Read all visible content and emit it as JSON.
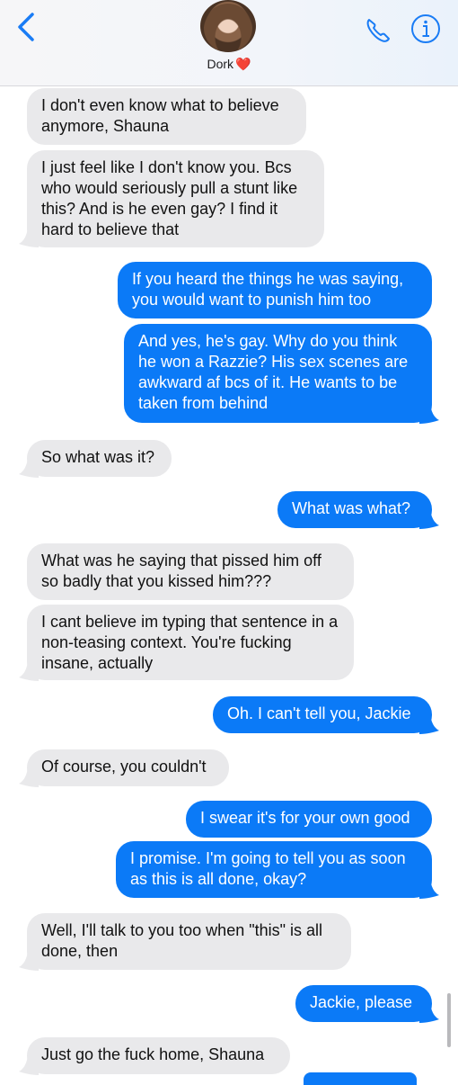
{
  "header": {
    "contact_name": "Dork",
    "heart_icon": "❤️",
    "back_icon": "chevron-left-icon",
    "phone_icon": "phone-icon",
    "info_icon": "info-icon",
    "accent": "#1a7cf5"
  },
  "colors": {
    "sent": "#0b7af7",
    "received": "#e9e9eb"
  },
  "messages": [
    {
      "dir": "received",
      "text": "I don't even know what to believe anymore, Shauna"
    },
    {
      "dir": "received",
      "text": "I just feel like I don't know you. Bcs who would seriously pull a stunt like this? And is he even gay? I find it hard to believe that"
    },
    {
      "dir": "sent",
      "text": "If you heard the things he was saying, you would want to punish him too"
    },
    {
      "dir": "sent",
      "text": "And yes, he's gay. Why do you think he won a Razzie? His sex scenes are awkward af bcs of it. He wants to be taken from behind"
    },
    {
      "dir": "received",
      "text": "So what was it?"
    },
    {
      "dir": "sent",
      "text": "What was what?"
    },
    {
      "dir": "received",
      "text": "What was he saying that pissed him off so badly that you kissed him???"
    },
    {
      "dir": "received",
      "text": "I cant believe im typing that sentence in a non-teasing context. You're fucking insane, actually"
    },
    {
      "dir": "sent",
      "text": "Oh. I can't tell you, Jackie"
    },
    {
      "dir": "received",
      "text": "Of course, you couldn't"
    },
    {
      "dir": "sent",
      "text": "I swear it's for your own good"
    },
    {
      "dir": "sent",
      "text": "I promise. I'm going to tell you as soon as this is all done, okay?"
    },
    {
      "dir": "received",
      "text": "Well, I'll talk to you too when \"this\" is all done, then"
    },
    {
      "dir": "sent",
      "text": "Jackie, please"
    },
    {
      "dir": "received",
      "text": "Just go the fuck home, Shauna"
    }
  ]
}
